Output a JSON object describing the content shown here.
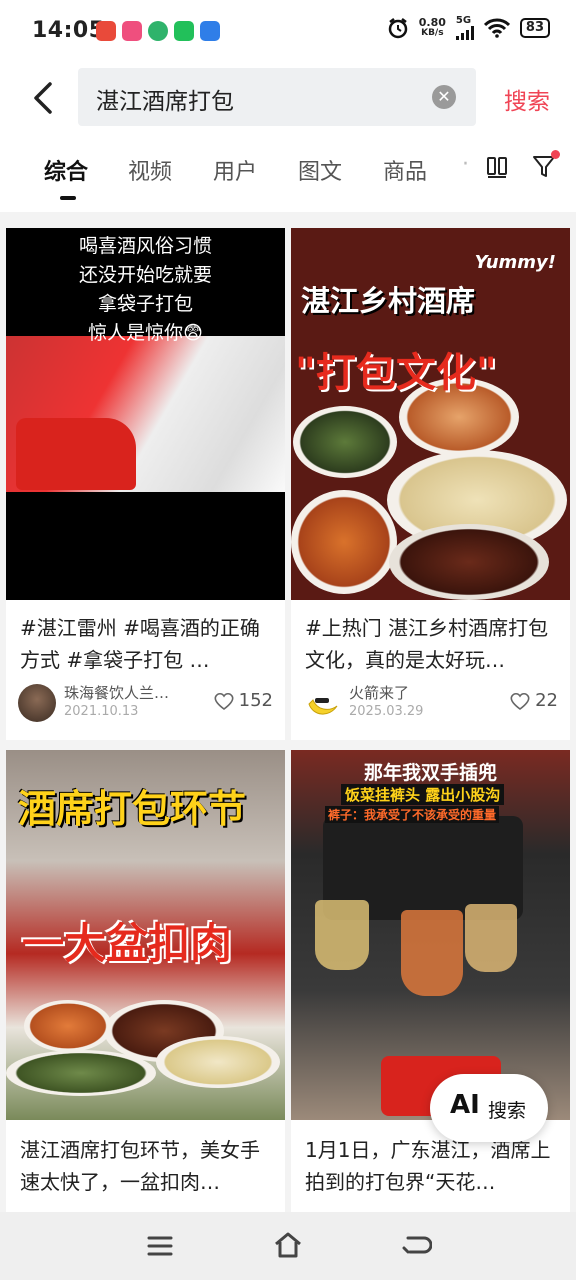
{
  "status": {
    "time": "14:05",
    "net_speed": "0.80",
    "net_unit": "KB/s",
    "net_type": "5G",
    "battery": "83"
  },
  "search": {
    "query": "湛江酒席打包",
    "button": "搜索"
  },
  "tabs": [
    "综合",
    "视频",
    "用户",
    "图文",
    "商品"
  ],
  "cards": [
    {
      "overlay": [
        "喝喜酒风俗习惯",
        "还没开始吃就要",
        "拿袋子打包",
        "惊人是惊你😨"
      ],
      "title": "#湛江雷州 #喝喜酒的正确方式 #拿袋子打包 …",
      "author": "珠海餐饮人兰…",
      "date": "2021.10.13",
      "likes": "152"
    },
    {
      "overlay": [
        "Yummy!",
        "湛江乡村酒席",
        "\"打包文化\""
      ],
      "title": "#上热门 湛江乡村酒席打包文化，真的是太好玩…",
      "author": "火箭来了",
      "date": "2025.03.29",
      "likes": "22"
    },
    {
      "overlay": [
        "酒席打包环节",
        "一大盆扣肉"
      ],
      "title": "湛江酒席打包环节，美女手速太快了，一盆扣肉…"
    },
    {
      "overlay": [
        "那年我双手插兜",
        "饭菜挂裤头 露出小股沟",
        "裤子：我承受了不该承受的重量"
      ],
      "title": "1月1日，广东湛江，酒席上拍到的打包界“天花…"
    }
  ],
  "ai_button": {
    "icon": "AI",
    "label": "搜索"
  },
  "colors": {
    "accent": "#f04455"
  }
}
